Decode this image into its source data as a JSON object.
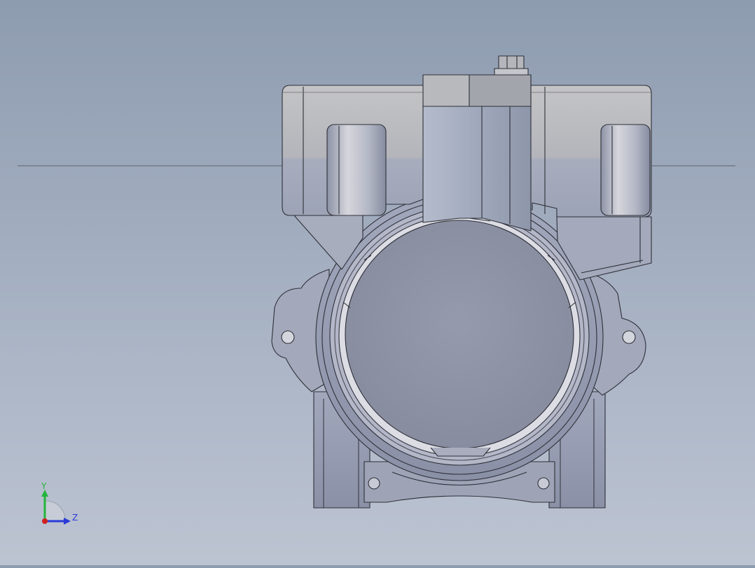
{
  "viewport": {
    "background_top": "#8e9cb0",
    "background_bottom": "#bcc4d2"
  },
  "model": {
    "body_color": "#9ea4b8",
    "housing_color": "#b9bbbf",
    "edge_color": "#2e3038"
  },
  "triad": {
    "y_label": "Y",
    "z_label": "Z",
    "y_color": "#22b43c",
    "z_color": "#2a3ad8",
    "x_color": "#d02020"
  }
}
